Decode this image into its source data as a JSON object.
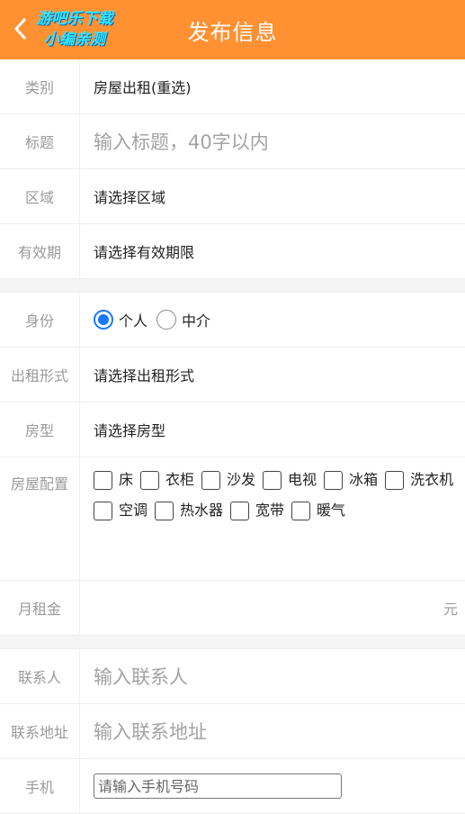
{
  "header": {
    "title": "发布信息",
    "watermark": [
      "游吧乐下载",
      "小编亲测"
    ]
  },
  "section1": {
    "category": {
      "label": "类别",
      "value": "房屋出租(重选)"
    },
    "title": {
      "label": "标题",
      "placeholder": "输入标题，40字以内"
    },
    "area": {
      "label": "区域",
      "value": "请选择区域"
    },
    "validity": {
      "label": "有效期",
      "value": "请选择有效期限"
    }
  },
  "section2": {
    "identity": {
      "label": "身份",
      "options": [
        "个人",
        "中介"
      ],
      "selected": "个人"
    },
    "rent_type": {
      "label": "出租形式",
      "value": "请选择出租形式"
    },
    "room_type": {
      "label": "房型",
      "value": "请选择房型"
    },
    "config": {
      "label": "房屋配置",
      "items": [
        "床",
        "衣柜",
        "沙发",
        "电视",
        "冰箱",
        "洗衣机",
        "空调",
        "热水器",
        "宽带",
        "暖气"
      ]
    },
    "monthly_rent": {
      "label": "月租金",
      "unit": "元"
    }
  },
  "section3": {
    "contact": {
      "label": "联系人",
      "placeholder": "输入联系人"
    },
    "address": {
      "label": "联系地址",
      "placeholder": "输入联系地址"
    },
    "phone": {
      "label": "手机",
      "placeholder": "请输入手机号码"
    }
  },
  "colors": {
    "header": "#ff9133",
    "radio_selected": "#1677ff"
  },
  "icons": {
    "back": "chevron-left-icon"
  }
}
